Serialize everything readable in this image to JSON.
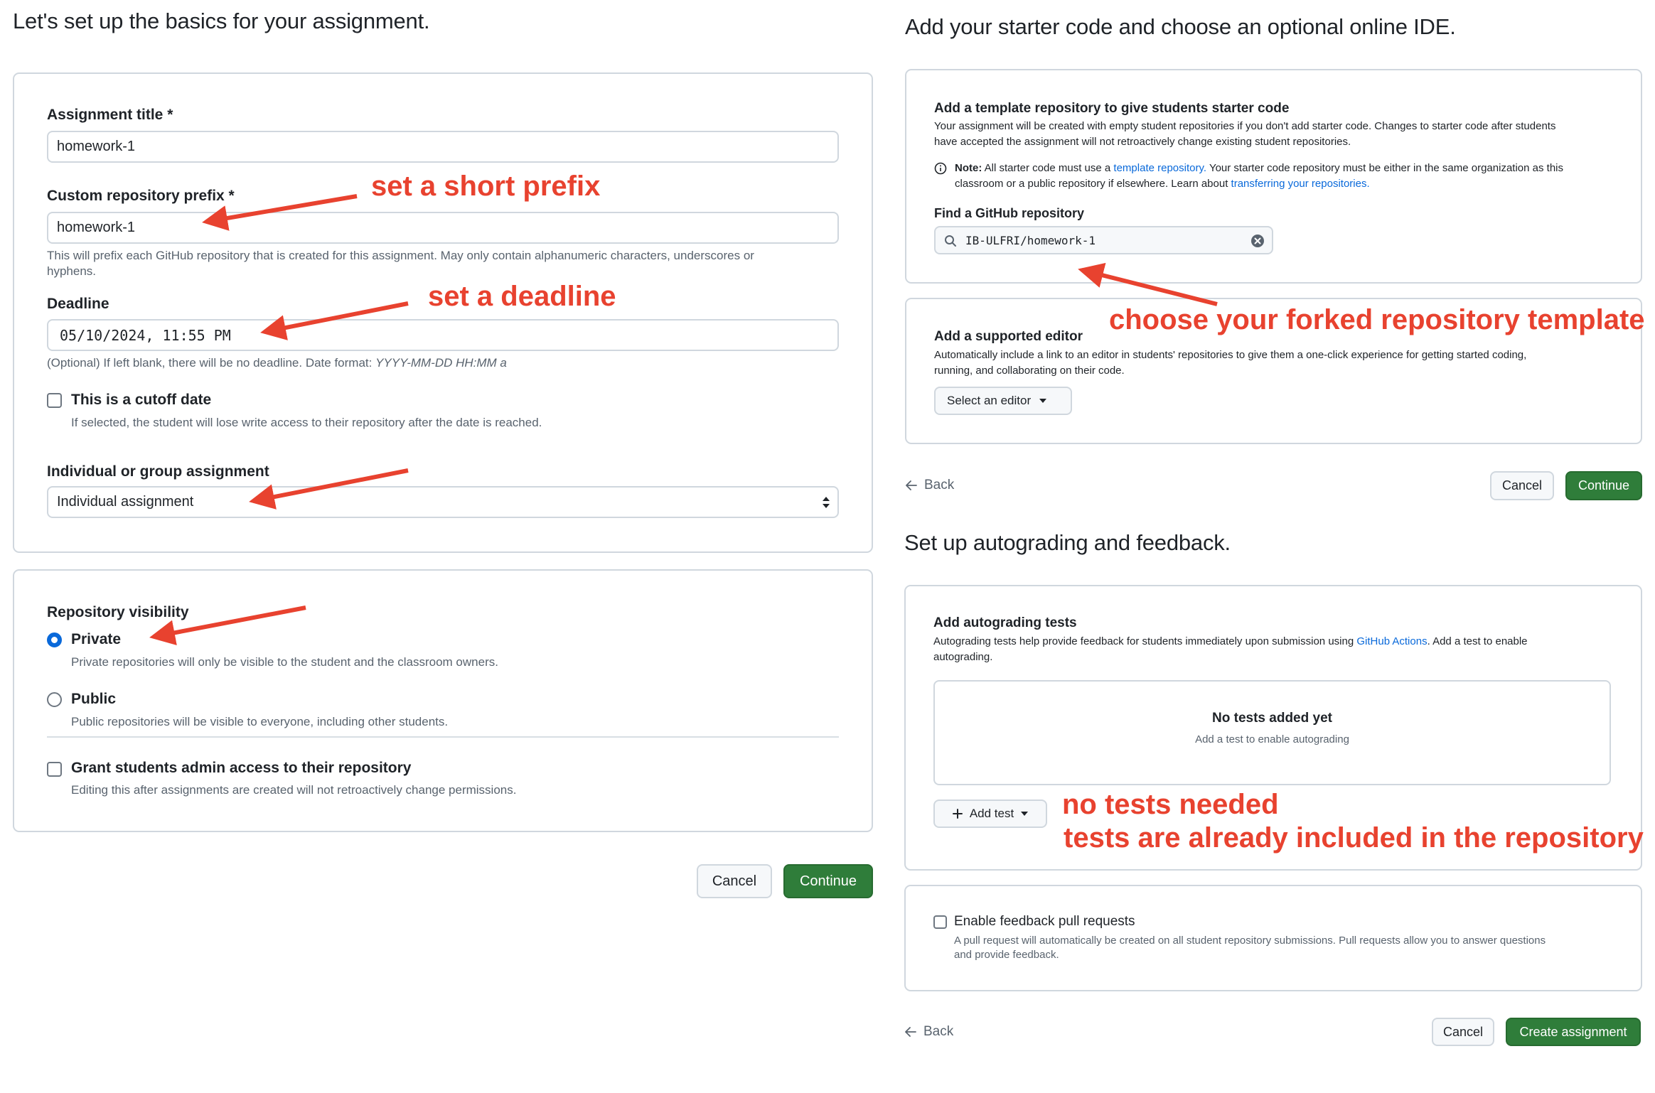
{
  "colors": {
    "accent": "#0969da",
    "primary_button": "#2f7d3a",
    "annotation": "#e8422f",
    "border": "#d0d7de"
  },
  "left": {
    "title": "Let's set up the basics for your assignment.",
    "assignment_title": {
      "label": "Assignment title *",
      "value": "homework-1"
    },
    "prefix": {
      "label": "Custom repository prefix *",
      "value": "homework-1",
      "help_1": "This will prefix each GitHub repository that is created for this assignment. May only contain alphanumeric characters, underscores or",
      "help_2": "hyphens."
    },
    "deadline": {
      "label": "Deadline",
      "value": "05/10/2024, 11:55 PM",
      "help": "(Optional) If left blank, there will be no deadline. Date format:",
      "format": "YYYY-MM-DD HH:MM a"
    },
    "cutoff": {
      "label": "This is a cutoff date",
      "help": "If selected, the student will lose write access to their repository after the date is reached."
    },
    "group": {
      "label": "Individual or group assignment",
      "value": "Individual assignment"
    },
    "visibility": {
      "label": "Repository visibility",
      "private_label": "Private",
      "private_help": "Private repositories will only be visible to the student and the classroom owners.",
      "public_label": "Public",
      "public_help": "Public repositories will be visible to everyone, including other students."
    },
    "admin": {
      "label": "Grant students admin access to their repository",
      "help": "Editing this after assignments are created will not retroactively change permissions."
    },
    "cancel": "Cancel",
    "continue": "Continue"
  },
  "right": {
    "title": "Add your starter code and choose an optional online IDE.",
    "template": {
      "heading": "Add a template repository to give students starter code",
      "desc_1": "Your assignment will be created with empty student repositories if you don't add starter code. Changes to starter code after students",
      "desc_2": "have accepted the assignment will not retroactively change existing student repositories.",
      "note_bold": "Note:",
      "note_1a": "All starter code must use a",
      "note_link1": "template repository.",
      "note_1b": "Your starter code repository must be either in the same organization as this",
      "note_2a": "classroom or a public repository if elsewhere. Learn about",
      "note_link2": "transferring your repositories.",
      "find_label": "Find a GitHub repository",
      "find_value": "IB-ULFRI/homework-1"
    },
    "editor": {
      "heading": "Add a supported editor",
      "desc_1": "Automatically include a link to an editor in students' repositories to give them a one-click experience for getting started coding,",
      "desc_2": "running, and collaborating on their code.",
      "select": "Select an editor"
    },
    "back": "Back",
    "cancel": "Cancel",
    "continue": "Continue",
    "autograde_title": "Set up autograding and feedback.",
    "autograde": {
      "heading": "Add autograding tests",
      "desc_1a": "Autograding tests help provide feedback for students immediately upon submission using",
      "desc_link": "GitHub Actions",
      "desc_1b": ". Add a test to enable",
      "desc_2": "autograding.",
      "empty_title": "No tests added yet",
      "empty_help": "Add a test to enable autograding",
      "add_test": "Add test"
    },
    "feedback": {
      "label": "Enable feedback pull requests",
      "help_1": "A pull request will automatically be created on all student repository submissions. Pull requests allow you to answer questions",
      "help_2": "and provide feedback."
    },
    "back2": "Back",
    "cancel2": "Cancel",
    "create": "Create assignment"
  },
  "annotations": {
    "prefix": "set a short prefix",
    "deadline": "set a deadline",
    "template": "choose your forked repository template",
    "tests_1": "no tests needed",
    "tests_2": "tests are already included in the repository"
  }
}
